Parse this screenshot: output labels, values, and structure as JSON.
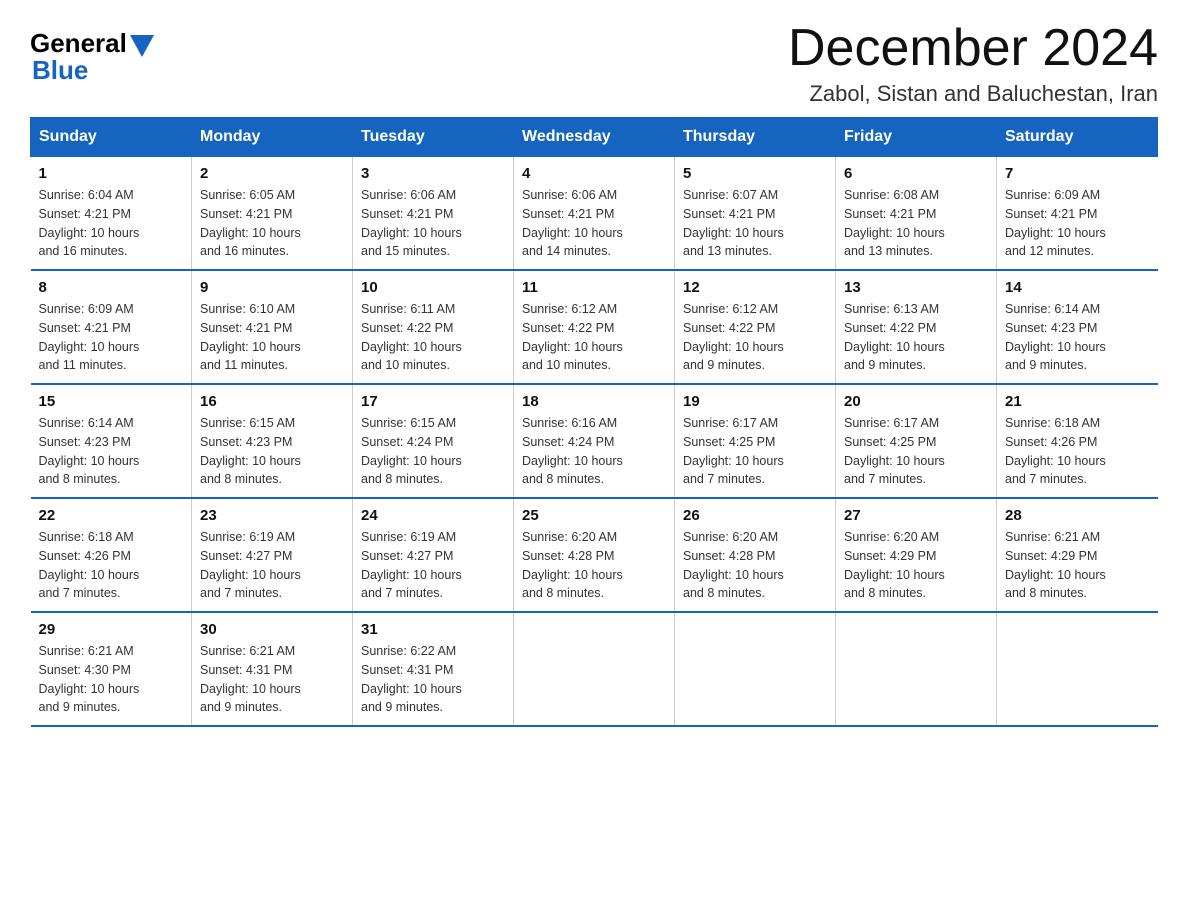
{
  "header": {
    "logo_general": "General",
    "logo_blue": "Blue",
    "month_title": "December 2024",
    "location": "Zabol, Sistan and Baluchestan, Iran"
  },
  "days_of_week": [
    "Sunday",
    "Monday",
    "Tuesday",
    "Wednesday",
    "Thursday",
    "Friday",
    "Saturday"
  ],
  "weeks": [
    [
      {
        "day": "1",
        "sunrise": "6:04 AM",
        "sunset": "4:21 PM",
        "daylight": "10 hours and 16 minutes."
      },
      {
        "day": "2",
        "sunrise": "6:05 AM",
        "sunset": "4:21 PM",
        "daylight": "10 hours and 16 minutes."
      },
      {
        "day": "3",
        "sunrise": "6:06 AM",
        "sunset": "4:21 PM",
        "daylight": "10 hours and 15 minutes."
      },
      {
        "day": "4",
        "sunrise": "6:06 AM",
        "sunset": "4:21 PM",
        "daylight": "10 hours and 14 minutes."
      },
      {
        "day": "5",
        "sunrise": "6:07 AM",
        "sunset": "4:21 PM",
        "daylight": "10 hours and 13 minutes."
      },
      {
        "day": "6",
        "sunrise": "6:08 AM",
        "sunset": "4:21 PM",
        "daylight": "10 hours and 13 minutes."
      },
      {
        "day": "7",
        "sunrise": "6:09 AM",
        "sunset": "4:21 PM",
        "daylight": "10 hours and 12 minutes."
      }
    ],
    [
      {
        "day": "8",
        "sunrise": "6:09 AM",
        "sunset": "4:21 PM",
        "daylight": "10 hours and 11 minutes."
      },
      {
        "day": "9",
        "sunrise": "6:10 AM",
        "sunset": "4:21 PM",
        "daylight": "10 hours and 11 minutes."
      },
      {
        "day": "10",
        "sunrise": "6:11 AM",
        "sunset": "4:22 PM",
        "daylight": "10 hours and 10 minutes."
      },
      {
        "day": "11",
        "sunrise": "6:12 AM",
        "sunset": "4:22 PM",
        "daylight": "10 hours and 10 minutes."
      },
      {
        "day": "12",
        "sunrise": "6:12 AM",
        "sunset": "4:22 PM",
        "daylight": "10 hours and 9 minutes."
      },
      {
        "day": "13",
        "sunrise": "6:13 AM",
        "sunset": "4:22 PM",
        "daylight": "10 hours and 9 minutes."
      },
      {
        "day": "14",
        "sunrise": "6:14 AM",
        "sunset": "4:23 PM",
        "daylight": "10 hours and 9 minutes."
      }
    ],
    [
      {
        "day": "15",
        "sunrise": "6:14 AM",
        "sunset": "4:23 PM",
        "daylight": "10 hours and 8 minutes."
      },
      {
        "day": "16",
        "sunrise": "6:15 AM",
        "sunset": "4:23 PM",
        "daylight": "10 hours and 8 minutes."
      },
      {
        "day": "17",
        "sunrise": "6:15 AM",
        "sunset": "4:24 PM",
        "daylight": "10 hours and 8 minutes."
      },
      {
        "day": "18",
        "sunrise": "6:16 AM",
        "sunset": "4:24 PM",
        "daylight": "10 hours and 8 minutes."
      },
      {
        "day": "19",
        "sunrise": "6:17 AM",
        "sunset": "4:25 PM",
        "daylight": "10 hours and 7 minutes."
      },
      {
        "day": "20",
        "sunrise": "6:17 AM",
        "sunset": "4:25 PM",
        "daylight": "10 hours and 7 minutes."
      },
      {
        "day": "21",
        "sunrise": "6:18 AM",
        "sunset": "4:26 PM",
        "daylight": "10 hours and 7 minutes."
      }
    ],
    [
      {
        "day": "22",
        "sunrise": "6:18 AM",
        "sunset": "4:26 PM",
        "daylight": "10 hours and 7 minutes."
      },
      {
        "day": "23",
        "sunrise": "6:19 AM",
        "sunset": "4:27 PM",
        "daylight": "10 hours and 7 minutes."
      },
      {
        "day": "24",
        "sunrise": "6:19 AM",
        "sunset": "4:27 PM",
        "daylight": "10 hours and 7 minutes."
      },
      {
        "day": "25",
        "sunrise": "6:20 AM",
        "sunset": "4:28 PM",
        "daylight": "10 hours and 8 minutes."
      },
      {
        "day": "26",
        "sunrise": "6:20 AM",
        "sunset": "4:28 PM",
        "daylight": "10 hours and 8 minutes."
      },
      {
        "day": "27",
        "sunrise": "6:20 AM",
        "sunset": "4:29 PM",
        "daylight": "10 hours and 8 minutes."
      },
      {
        "day": "28",
        "sunrise": "6:21 AM",
        "sunset": "4:29 PM",
        "daylight": "10 hours and 8 minutes."
      }
    ],
    [
      {
        "day": "29",
        "sunrise": "6:21 AM",
        "sunset": "4:30 PM",
        "daylight": "10 hours and 9 minutes."
      },
      {
        "day": "30",
        "sunrise": "6:21 AM",
        "sunset": "4:31 PM",
        "daylight": "10 hours and 9 minutes."
      },
      {
        "day": "31",
        "sunrise": "6:22 AM",
        "sunset": "4:31 PM",
        "daylight": "10 hours and 9 minutes."
      },
      null,
      null,
      null,
      null
    ]
  ],
  "labels": {
    "sunrise": "Sunrise:",
    "sunset": "Sunset:",
    "daylight": "Daylight:"
  }
}
